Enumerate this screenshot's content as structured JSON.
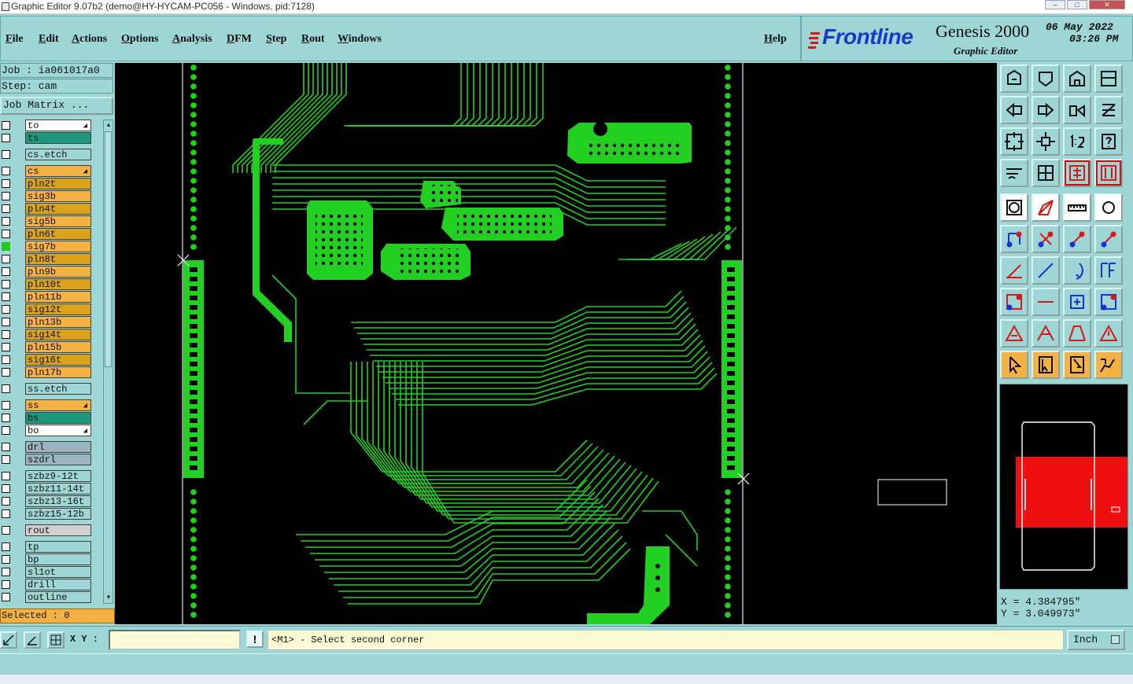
{
  "window": {
    "title": "Graphic Editor 9.07b2 (demo@HY-HYCAM-PC056 - Windows, pid:7128)",
    "controls": [
      "minimize",
      "maximize",
      "close"
    ]
  },
  "menu": {
    "items": [
      "File",
      "Edit",
      "Actions",
      "Options",
      "Analysis",
      "DFM",
      "Step",
      "Rout",
      "Windows"
    ],
    "help": "Help"
  },
  "logo": {
    "brand": "Frontline",
    "product": "Genesis 2000",
    "subtitle": "Graphic Editor",
    "date": "06 May 2022",
    "time": "03:26 PM"
  },
  "job": {
    "job_line": "Job : ia061017a0",
    "step_line": "Step: cam",
    "matrix_button": "Job Matrix ..."
  },
  "layers": [
    {
      "name": "to",
      "color": "#ffffff",
      "checked": false,
      "flag": true,
      "gap_before": false
    },
    {
      "name": "ts",
      "color": "#1a9a7a",
      "checked": false,
      "flag": false,
      "gap_before": false
    },
    {
      "name": "cs.etch",
      "color": "#9ed6d6",
      "checked": false,
      "flag": false,
      "gap_before": true
    },
    {
      "name": "cs",
      "color": "#f4b244",
      "checked": false,
      "flag": true,
      "gap_before": true
    },
    {
      "name": "pln2t",
      "color": "#d8a21a",
      "checked": false,
      "flag": false,
      "gap_before": false
    },
    {
      "name": "sig3b",
      "color": "#f4b244",
      "checked": false,
      "flag": false,
      "gap_before": false
    },
    {
      "name": "pln4t",
      "color": "#d8a21a",
      "checked": false,
      "flag": false,
      "gap_before": false
    },
    {
      "name": "sig5b",
      "color": "#f4b244",
      "checked": false,
      "flag": false,
      "gap_before": false
    },
    {
      "name": "pln6t",
      "color": "#d8a21a",
      "checked": false,
      "flag": false,
      "gap_before": false
    },
    {
      "name": "sig7b",
      "color": "#f4b244",
      "checked": true,
      "flag": false,
      "gap_before": false
    },
    {
      "name": "pln8t",
      "color": "#d8a21a",
      "checked": false,
      "flag": false,
      "gap_before": false
    },
    {
      "name": "pln9b",
      "color": "#f4b244",
      "checked": false,
      "flag": false,
      "gap_before": false
    },
    {
      "name": "pln10t",
      "color": "#d8a21a",
      "checked": false,
      "flag": false,
      "gap_before": false
    },
    {
      "name": "pln11b",
      "color": "#f4b244",
      "checked": false,
      "flag": false,
      "gap_before": false
    },
    {
      "name": "sig12t",
      "color": "#d8a21a",
      "checked": false,
      "flag": false,
      "gap_before": false
    },
    {
      "name": "pln13b",
      "color": "#f4b244",
      "checked": false,
      "flag": false,
      "gap_before": false
    },
    {
      "name": "sig14t",
      "color": "#d8a21a",
      "checked": false,
      "flag": false,
      "gap_before": false
    },
    {
      "name": "pln15b",
      "color": "#f4b244",
      "checked": false,
      "flag": false,
      "gap_before": false
    },
    {
      "name": "sig16t",
      "color": "#d8a21a",
      "checked": false,
      "flag": false,
      "gap_before": false
    },
    {
      "name": "pln17b",
      "color": "#f4b244",
      "checked": false,
      "flag": false,
      "gap_before": false
    },
    {
      "name": "ss.etch",
      "color": "#9ed6d6",
      "checked": false,
      "flag": false,
      "gap_before": true
    },
    {
      "name": "ss",
      "color": "#f4b244",
      "checked": false,
      "flag": true,
      "gap_before": true
    },
    {
      "name": "bs",
      "color": "#1a9a7a",
      "checked": false,
      "flag": false,
      "gap_before": false
    },
    {
      "name": "bo",
      "color": "#ffffff",
      "checked": false,
      "flag": true,
      "gap_before": false
    },
    {
      "name": "drl",
      "color": "#9ab4c0",
      "checked": false,
      "flag": false,
      "gap_before": true
    },
    {
      "name": "szdrl",
      "color": "#9ab4c0",
      "checked": false,
      "flag": false,
      "gap_before": false
    },
    {
      "name": "szbz9-12t",
      "color": "#9ed6d6",
      "checked": false,
      "flag": false,
      "gap_before": true
    },
    {
      "name": "szbz11-14t",
      "color": "#9ed6d6",
      "checked": false,
      "flag": false,
      "gap_before": false
    },
    {
      "name": "szbz13-16t",
      "color": "#9ed6d6",
      "checked": false,
      "flag": false,
      "gap_before": false
    },
    {
      "name": "szbz15-12b",
      "color": "#9ed6d6",
      "checked": false,
      "flag": false,
      "gap_before": false
    },
    {
      "name": "rout",
      "color": "#d0d0d0",
      "checked": false,
      "flag": false,
      "gap_before": true
    },
    {
      "name": "tp",
      "color": "#9ed6d6",
      "checked": false,
      "flag": false,
      "gap_before": true
    },
    {
      "name": "bp",
      "color": "#9ed6d6",
      "checked": false,
      "flag": false,
      "gap_before": false
    },
    {
      "name": "sl1ot",
      "color": "#9ed6d6",
      "checked": false,
      "flag": false,
      "gap_before": false
    },
    {
      "name": "drill",
      "color": "#9ed6d6",
      "checked": false,
      "flag": false,
      "gap_before": false
    },
    {
      "name": "outline",
      "color": "#9ed6d6",
      "checked": false,
      "flag": false,
      "gap_before": false
    }
  ],
  "selected": "Selected : 0",
  "coords": {
    "x": "X = 4.384795\"",
    "y": "Y = 3.049973\""
  },
  "bottom": {
    "xy_label": "X Y :",
    "xy_value": "",
    "excl": "!",
    "prompt": "<M1> - Select second corner",
    "unit": "Inch"
  },
  "colors": {
    "background": "#9ed6d6",
    "canvas": "#000000",
    "copper": "#22d022",
    "accent_orange": "#f4b244",
    "overview_red": "#ee1010"
  },
  "toolbar_icons": [
    "zoom-home-icon",
    "zoom-home2-icon",
    "home-icon",
    "overlay-icon",
    "pan-left-icon",
    "pan-right-icon",
    "flip-icon",
    "snap-icon",
    "zoom-fit-icon",
    "zoom-fit2-icon",
    "one-to-one-icon",
    "help-icon",
    "measure-icon",
    "grid-icon",
    "layers-icon",
    "layers2-icon",
    "fill-icon",
    "angle-icon",
    "ruler-icon",
    "pad-icon",
    "nodes-icon",
    "cross-icon",
    "link-icon",
    "link2-icon",
    "line-icon",
    "slope-icon",
    "arc-icon",
    "text-icon",
    "scatter-icon",
    "dash-icon",
    "resize-icon",
    "cluster-icon",
    "tri1-icon",
    "tri2-icon",
    "tri3-icon",
    "tri4-icon",
    "pointer-icon",
    "pointer2-icon",
    "pointer3-icon",
    "route-icon"
  ]
}
